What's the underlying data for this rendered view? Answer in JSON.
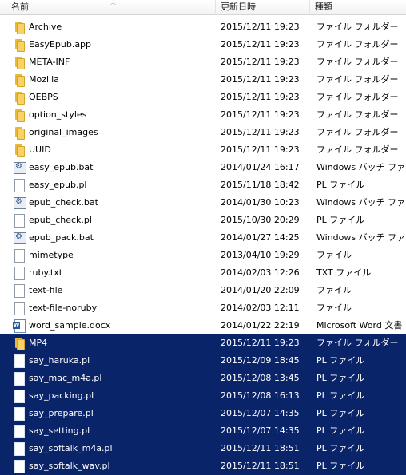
{
  "columns": {
    "name": "名前",
    "date": "更新日時",
    "type": "種類"
  },
  "sort_indicator": "︿",
  "colors": {
    "selection": "#0a246a",
    "folder": "#f6d36a"
  },
  "rows": [
    {
      "name": "Archive",
      "date": "2015/12/11 19:23",
      "type": "ファイル フォルダー",
      "icon": "folder-icon"
    },
    {
      "name": "EasyEpub.app",
      "date": "2015/12/11 19:23",
      "type": "ファイル フォルダー",
      "icon": "folder-icon"
    },
    {
      "name": "META-INF",
      "date": "2015/12/11 19:23",
      "type": "ファイル フォルダー",
      "icon": "folder-icon"
    },
    {
      "name": "Mozilla",
      "date": "2015/12/11 19:23",
      "type": "ファイル フォルダー",
      "icon": "folder-icon"
    },
    {
      "name": "OEBPS",
      "date": "2015/12/11 19:23",
      "type": "ファイル フォルダー",
      "icon": "folder-icon"
    },
    {
      "name": "option_styles",
      "date": "2015/12/11 19:23",
      "type": "ファイル フォルダー",
      "icon": "folder-icon"
    },
    {
      "name": "original_images",
      "date": "2015/12/11 19:23",
      "type": "ファイル フォルダー",
      "icon": "folder-icon"
    },
    {
      "name": "UUID",
      "date": "2015/12/11 19:23",
      "type": "ファイル フォルダー",
      "icon": "folder-icon"
    },
    {
      "name": "easy_epub.bat",
      "date": "2014/01/24 16:17",
      "type": "Windows バッチ ファ...",
      "icon": "batch-file-icon"
    },
    {
      "name": "easy_epub.pl",
      "date": "2015/11/18 18:42",
      "type": "PL ファイル",
      "icon": "document-icon"
    },
    {
      "name": "epub_check.bat",
      "date": "2014/01/30 10:23",
      "type": "Windows バッチ ファ...",
      "icon": "batch-file-icon"
    },
    {
      "name": "epub_check.pl",
      "date": "2015/10/30 20:29",
      "type": "PL ファイル",
      "icon": "document-icon"
    },
    {
      "name": "epub_pack.bat",
      "date": "2014/01/27 14:25",
      "type": "Windows バッチ ファ...",
      "icon": "batch-file-icon"
    },
    {
      "name": "mimetype",
      "date": "2013/04/10 19:29",
      "type": "ファイル",
      "icon": "document-icon"
    },
    {
      "name": "ruby.txt",
      "date": "2014/02/03 12:26",
      "type": "TXT ファイル",
      "icon": "document-icon"
    },
    {
      "name": "text-file",
      "date": "2014/01/20 22:09",
      "type": "ファイル",
      "icon": "document-icon"
    },
    {
      "name": "text-file-noruby",
      "date": "2014/02/03 12:11",
      "type": "ファイル",
      "icon": "document-icon"
    },
    {
      "name": "word_sample.docx",
      "date": "2014/01/22 22:19",
      "type": "Microsoft Word 文書",
      "icon": "word-document-icon"
    },
    {
      "name": "MP4",
      "date": "2015/12/11 19:23",
      "type": "ファイル フォルダー",
      "icon": "folder-icon",
      "selected": true
    },
    {
      "name": "say_haruka.pl",
      "date": "2015/12/09 18:45",
      "type": "PL ファイル",
      "icon": "document-icon",
      "selected": true
    },
    {
      "name": "say_mac_m4a.pl",
      "date": "2015/12/08 13:45",
      "type": "PL ファイル",
      "icon": "document-icon",
      "selected": true
    },
    {
      "name": "say_packing.pl",
      "date": "2015/12/08 16:13",
      "type": "PL ファイル",
      "icon": "document-icon",
      "selected": true
    },
    {
      "name": "say_prepare.pl",
      "date": "2015/12/07 14:35",
      "type": "PL ファイル",
      "icon": "document-icon",
      "selected": true
    },
    {
      "name": "say_setting.pl",
      "date": "2015/12/07 14:35",
      "type": "PL ファイル",
      "icon": "document-icon",
      "selected": true
    },
    {
      "name": "say_softalk_m4a.pl",
      "date": "2015/12/11 18:51",
      "type": "PL ファイル",
      "icon": "document-icon",
      "selected": true
    },
    {
      "name": "say_softalk_wav.pl",
      "date": "2015/12/11 18:51",
      "type": "PL ファイル",
      "icon": "document-icon",
      "selected": true
    }
  ]
}
